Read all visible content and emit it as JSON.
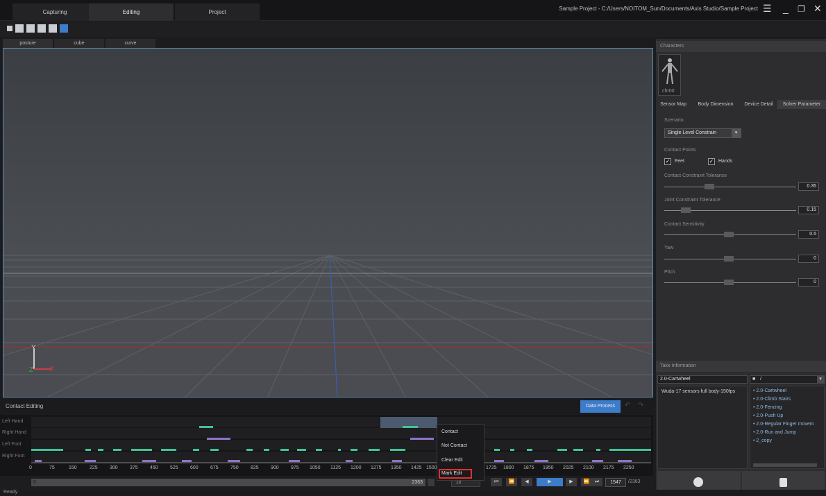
{
  "main_tabs": [
    {
      "label": "Capturing"
    },
    {
      "label": "Editing"
    },
    {
      "label": "Project"
    }
  ],
  "window_title": "Sample Project - C:/Users/NOITOM_Sun/Documents/Axis Studio/Sample Project",
  "view_tabs": [
    {
      "label": "posture"
    },
    {
      "label": "cube"
    },
    {
      "label": "curve"
    }
  ],
  "characters": {
    "header": "Characters",
    "item_label": "chr00"
  },
  "right_tabs": [
    {
      "label": "Sensor Map"
    },
    {
      "label": "Body Dimension"
    },
    {
      "label": "Device Detail"
    },
    {
      "label": "Solver Parameter"
    }
  ],
  "solver": {
    "scenario_label": "Scenario",
    "scenario_value": "Single Level Constrain",
    "contact_points_label": "Contact Points",
    "feet_label": "Feet",
    "hands_label": "Hands",
    "sliders": [
      {
        "label": "Contact Constraint Tolerance",
        "value": "0.35",
        "level": 0.3
      },
      {
        "label": "Joint Constraint Tolerance",
        "value": "0.15",
        "level": 0.15
      },
      {
        "label": "Contact Sensitivity",
        "value": "0.5",
        "level": 0.5
      },
      {
        "label": "Yaw",
        "value": "0",
        "level": 0.5
      },
      {
        "label": "Pitch",
        "value": "0",
        "level": 0.5
      }
    ]
  },
  "take_info": {
    "header": "Take Information",
    "take_name": "2.0-Cartwheel",
    "folder": "/",
    "description": "Wuda-17 sensors full body-150fps",
    "takes": [
      "• 2.0-Cartwheel",
      "• 2.0-Climb Stairs",
      "• 2.0-Fencing",
      "• 2.0-Push Up",
      "• 2.0-Regular Finger movem",
      "• 2.0-Run and Jump",
      "• 2_copy"
    ]
  },
  "contact_editing": {
    "title": "Contact Editing",
    "data_process": "Data Process",
    "tracks": [
      "Left Hand",
      "Right Hand",
      "Left Foot",
      "Right Foot"
    ],
    "ticks": [
      "0",
      "75",
      "150",
      "225",
      "300",
      "375",
      "450",
      "525",
      "600",
      "675",
      "750",
      "825",
      "900",
      "975",
      "1050",
      "1125",
      "1200",
      "1275",
      "1350",
      "1425",
      "1500",
      "1725",
      "1800",
      "1875",
      "1950",
      "2025",
      "2100",
      "2175",
      "2250"
    ]
  },
  "context_menu": {
    "items": [
      "Contact",
      "Not Contact",
      "Clear Edit",
      "Mark Edit"
    ]
  },
  "playbar": {
    "left_value": "0",
    "right_value": "2363",
    "speed": "1x",
    "current_frame": "1547",
    "total_frames": "/2363"
  },
  "status": {
    "text": "Ready"
  },
  "colors": {
    "accent": "#3d7cc9",
    "contact_green": "#3fc495",
    "contact_purple": "#8f73c8",
    "highlight_red": "#e03030"
  }
}
